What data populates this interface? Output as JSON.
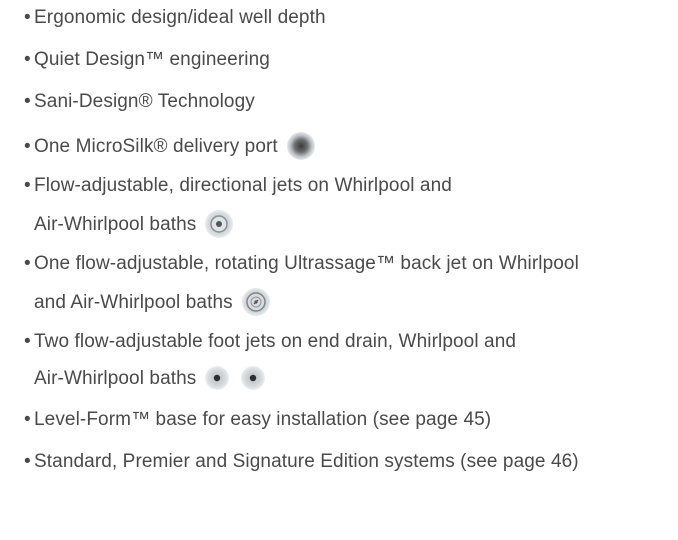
{
  "bullet": "•",
  "items": [
    {
      "lines": [
        "Ergonomic design/ideal well depth"
      ]
    },
    {
      "lines": [
        "Quiet Design™ engineering"
      ]
    },
    {
      "lines": [
        "Sani-Design® Technology"
      ]
    },
    {
      "lines": [
        "One MicroSilk® delivery port"
      ],
      "icons": [
        "microsilk-port-icon"
      ]
    },
    {
      "lines": [
        "Flow-adjustable, directional jets on Whirlpool and",
        "Air-Whirlpool baths"
      ],
      "icons": [
        "directional-jet-icon"
      ]
    },
    {
      "lines": [
        "One flow-adjustable, rotating Ultrassage™ back jet on Whirlpool",
        "and Air-Whirlpool baths"
      ],
      "icons": [
        "ultrassage-back-jet-icon"
      ]
    },
    {
      "lines": [
        "Two flow-adjustable foot jets on end drain, Whirlpool and",
        "Air-Whirlpool baths"
      ],
      "icons": [
        "foot-jet-icon",
        "foot-jet-icon"
      ]
    },
    {
      "lines": [
        "Level-Form™ base for easy installation (see page 45)"
      ]
    },
    {
      "lines": [
        "Standard, Premier and Signature Edition systems (see page 46)"
      ]
    }
  ]
}
